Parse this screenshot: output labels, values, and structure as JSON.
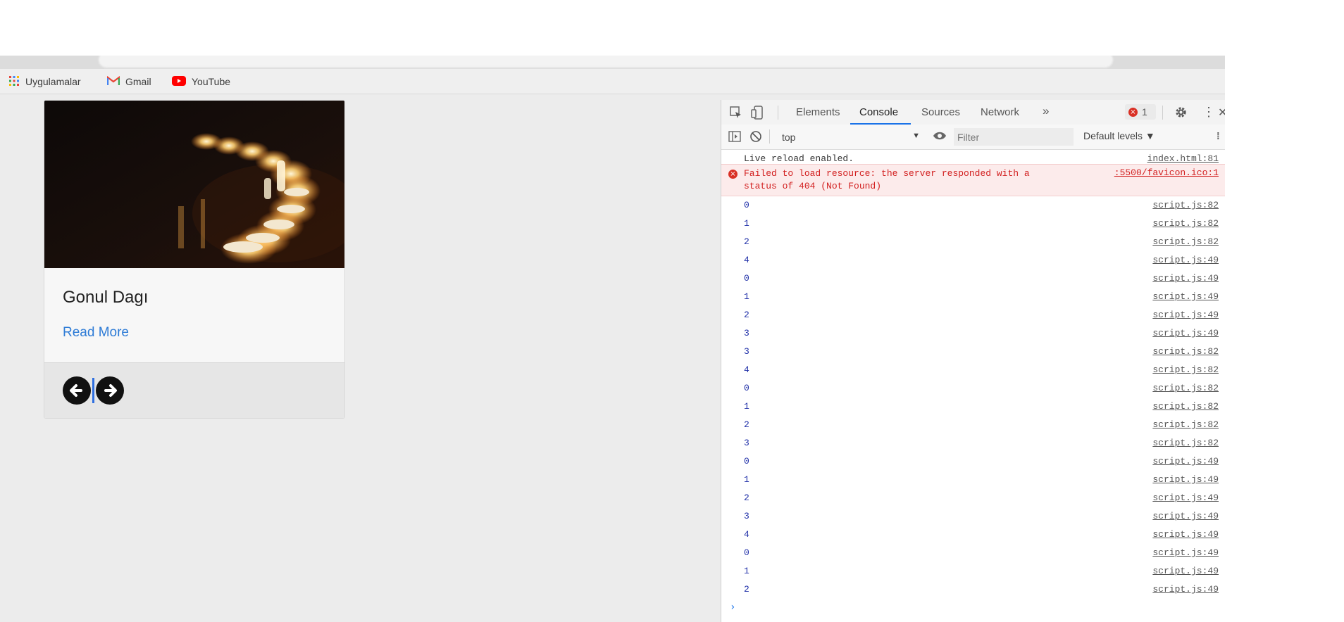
{
  "bookmarks": [
    {
      "label": "Uygulamalar",
      "icon": "apps-grid-icon"
    },
    {
      "label": "Gmail",
      "icon": "gmail-icon"
    },
    {
      "label": "YouTube",
      "icon": "youtube-icon"
    }
  ],
  "card": {
    "title": "Gonul Dagı",
    "link": "Read More",
    "image": "candles-photo"
  },
  "devtools": {
    "tabs": [
      "Elements",
      "Console",
      "Sources",
      "Network"
    ],
    "active_tab": "Console",
    "more_tabs": "»",
    "error_count": "1",
    "context": "top",
    "filter_placeholder": "Filter",
    "levels": "Default levels ▼"
  },
  "console": {
    "info": {
      "text": "Live reload enabled.",
      "source": "index.html:81"
    },
    "error": {
      "line1": "Failed to load resource: the server responded with a",
      "line2": "status of 404 (Not Found)",
      "source": ":5500/favicon.ico:1"
    },
    "logs": [
      {
        "value": "0",
        "source": "script.js:82"
      },
      {
        "value": "1",
        "source": "script.js:82"
      },
      {
        "value": "2",
        "source": "script.js:82"
      },
      {
        "value": "4",
        "source": "script.js:49"
      },
      {
        "value": "0",
        "source": "script.js:49"
      },
      {
        "value": "1",
        "source": "script.js:49"
      },
      {
        "value": "2",
        "source": "script.js:49"
      },
      {
        "value": "3",
        "source": "script.js:49"
      },
      {
        "value": "3",
        "source": "script.js:82"
      },
      {
        "value": "4",
        "source": "script.js:82"
      },
      {
        "value": "0",
        "source": "script.js:82"
      },
      {
        "value": "1",
        "source": "script.js:82"
      },
      {
        "value": "2",
        "source": "script.js:82"
      },
      {
        "value": "3",
        "source": "script.js:82"
      },
      {
        "value": "0",
        "source": "script.js:49"
      },
      {
        "value": "1",
        "source": "script.js:49"
      },
      {
        "value": "2",
        "source": "script.js:49"
      },
      {
        "value": "3",
        "source": "script.js:49"
      },
      {
        "value": "4",
        "source": "script.js:49"
      },
      {
        "value": "0",
        "source": "script.js:49"
      },
      {
        "value": "1",
        "source": "script.js:49"
      },
      {
        "value": "2",
        "source": "script.js:49"
      }
    ],
    "prompt": "›"
  },
  "colors": {
    "link": "#2d7bd6",
    "error": "#d21f1f",
    "log_number": "#1f2fa8",
    "devtools_accent": "#1a73e8"
  }
}
